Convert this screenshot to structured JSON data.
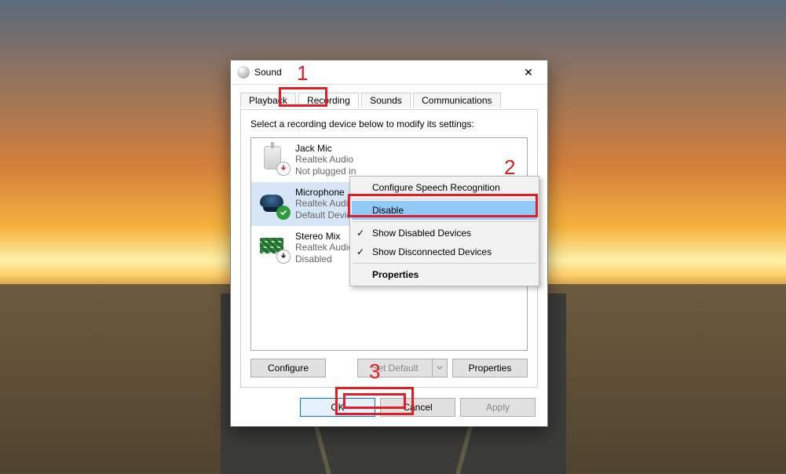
{
  "window": {
    "title": "Sound",
    "close_glyph": "✕"
  },
  "tabs": {
    "playback": "Playback",
    "recording": "Recording",
    "sounds": "Sounds",
    "communications": "Communications",
    "active_index": 1
  },
  "instruction": "Select a recording device below to modify its settings:",
  "devices": [
    {
      "name": "Jack Mic",
      "line2": "Realtek Audio",
      "line3": "Not plugged in",
      "badge": "red-down",
      "selected": false
    },
    {
      "name": "Microphone",
      "line2": "Realtek Audio",
      "line3": "Default Device",
      "badge": "green-check",
      "selected": true
    },
    {
      "name": "Stereo Mix",
      "line2": "Realtek Audio",
      "line3": "Disabled",
      "badge": "down",
      "selected": false
    }
  ],
  "buttons": {
    "configure": "Configure",
    "set_default": "Set Default",
    "properties": "Properties",
    "ok": "OK",
    "cancel": "Cancel",
    "apply": "Apply"
  },
  "context_menu": {
    "configure_speech": "Configure Speech Recognition",
    "disable": "Disable",
    "show_disabled": "Show Disabled Devices",
    "show_disconnected": "Show Disconnected Devices",
    "properties": "Properties",
    "check_glyph": "✓",
    "show_disabled_checked": true,
    "show_disconnected_checked": true,
    "highlighted": "disable"
  },
  "callouts": {
    "n1": "1",
    "n2": "2",
    "n3": "3"
  }
}
